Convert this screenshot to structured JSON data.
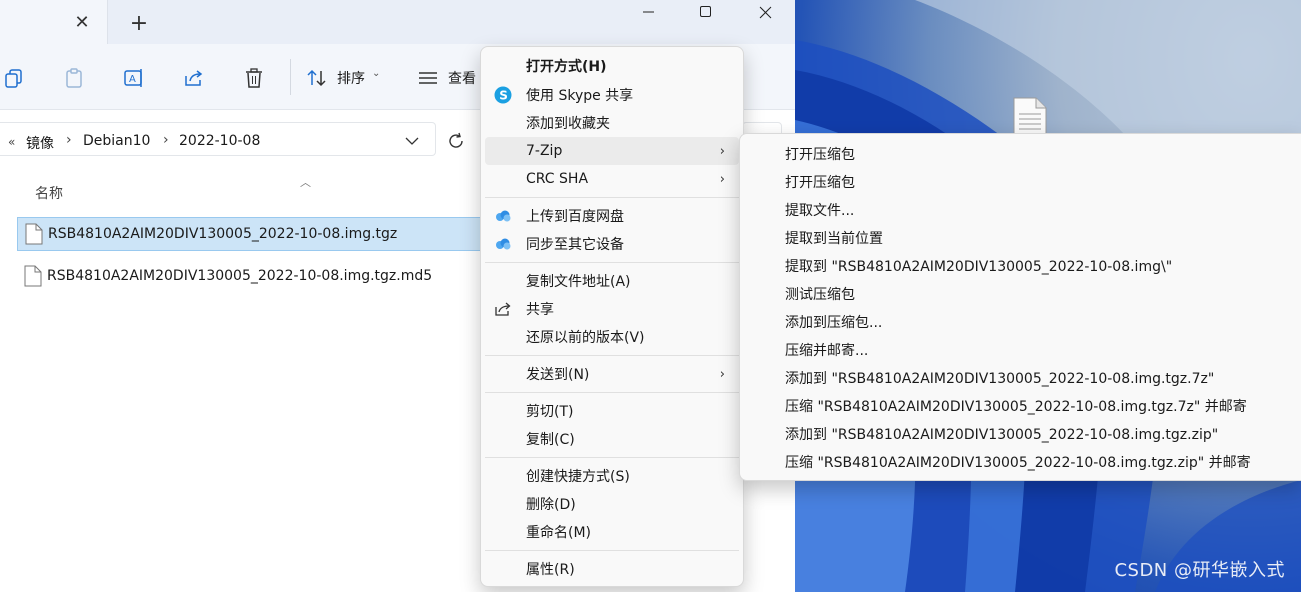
{
  "explorer": {
    "tab_close": "✕",
    "new_tab": "+",
    "window_buttons": {
      "minimize": "—",
      "maximize": "☐",
      "close": "✕"
    },
    "toolbar": {
      "sort_label": "排序",
      "view_label": "查看"
    },
    "breadcrumb": {
      "overflow": "«",
      "items": [
        "镜像",
        "Debian10",
        "2022-10-08"
      ],
      "sep": "›"
    },
    "column_header": "名称",
    "files": [
      {
        "name": "RSB4810A2AIM20DIV130005_2022-10-08.img.tgz",
        "selected": true
      },
      {
        "name": "RSB4810A2AIM20DIV130005_2022-10-08.img.tgz.md5",
        "selected": false
      }
    ]
  },
  "context_menu": {
    "items": [
      {
        "label": "打开方式(H)",
        "bold": true,
        "icon": ""
      },
      {
        "label": "使用 Skype 共享",
        "icon": "skype-icon"
      },
      {
        "label": "添加到收藏夹",
        "icon": ""
      },
      {
        "label": "7-Zip",
        "submenu": true,
        "hover": true
      },
      {
        "label": "CRC SHA",
        "submenu": true
      },
      {
        "label": "上传到百度网盘",
        "icon": "baidu-cloud-icon"
      },
      {
        "label": "同步至其它设备",
        "icon": "baidu-cloud-icon"
      },
      {
        "label": "复制文件地址(A)"
      },
      {
        "label": "共享",
        "icon": "share-icon"
      },
      {
        "label": "还原以前的版本(V)"
      },
      {
        "label": "发送到(N)",
        "submenu": true
      },
      {
        "label": "剪切(T)"
      },
      {
        "label": "复制(C)"
      },
      {
        "label": "创建快捷方式(S)"
      },
      {
        "label": "删除(D)"
      },
      {
        "label": "重命名(M)"
      },
      {
        "label": "属性(R)"
      }
    ],
    "chevron": "›"
  },
  "submenu_7zip": {
    "items": [
      "打开压缩包",
      "打开压缩包",
      "提取文件...",
      "提取到当前位置",
      "提取到 \"RSB4810A2AIM20DIV130005_2022-10-08.img\\\"",
      "测试压缩包",
      "添加到压缩包...",
      "压缩并邮寄...",
      "添加到 \"RSB4810A2AIM20DIV130005_2022-10-08.img.tgz.7z\"",
      "压缩 \"RSB4810A2AIM20DIV130005_2022-10-08.img.tgz.7z\" 并邮寄",
      "添加到 \"RSB4810A2AIM20DIV130005_2022-10-08.img.tgz.zip\"",
      "压缩 \"RSB4810A2AIM20DIV130005_2022-10-08.img.tgz.zip\" 并邮寄"
    ]
  },
  "watermark": "CSDN @研华嵌入式"
}
